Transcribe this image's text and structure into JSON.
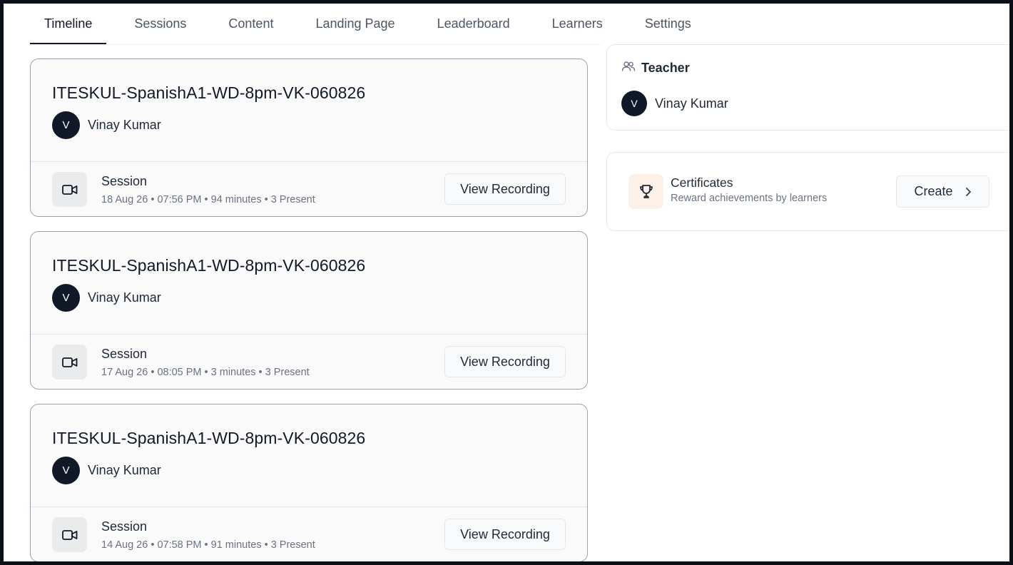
{
  "tabs": [
    {
      "label": "Timeline",
      "active": true
    },
    {
      "label": "Sessions",
      "active": false
    },
    {
      "label": "Content",
      "active": false
    },
    {
      "label": "Landing Page",
      "active": false
    },
    {
      "label": "Leaderboard",
      "active": false
    },
    {
      "label": "Learners",
      "active": false
    },
    {
      "label": "Settings",
      "active": false
    }
  ],
  "sessions": [
    {
      "title": "ITESKUL-SpanishA1-WD-8pm-VK-060826",
      "owner_initial": "V",
      "owner_name": "Vinay Kumar",
      "type_label": "Session",
      "meta": "18 Aug 26 • 07:56 PM • 94 minutes • 3 Present",
      "button_label": "View Recording"
    },
    {
      "title": "ITESKUL-SpanishA1-WD-8pm-VK-060826",
      "owner_initial": "V",
      "owner_name": "Vinay Kumar",
      "type_label": "Session",
      "meta": "17 Aug 26 • 08:05 PM • 3 minutes • 3 Present",
      "button_label": "View Recording"
    },
    {
      "title": "ITESKUL-SpanishA1-WD-8pm-VK-060826",
      "owner_initial": "V",
      "owner_name": "Vinay Kumar",
      "type_label": "Session",
      "meta": "14 Aug 26 • 07:58 PM • 91 minutes • 3 Present",
      "button_label": "View Recording"
    }
  ],
  "teacher": {
    "heading": "Teacher",
    "initial": "V",
    "name": "Vinay Kumar",
    "icon": "users-icon"
  },
  "certificates": {
    "title": "Certificates",
    "subtitle": "Reward achievements by learners",
    "button_label": "Create",
    "icon": "trophy-icon",
    "accent_color": "#fdf1e7"
  },
  "colors": {
    "active_tab": "#111827",
    "avatar_bg": "#111827",
    "card_border": "#9ca3af"
  }
}
